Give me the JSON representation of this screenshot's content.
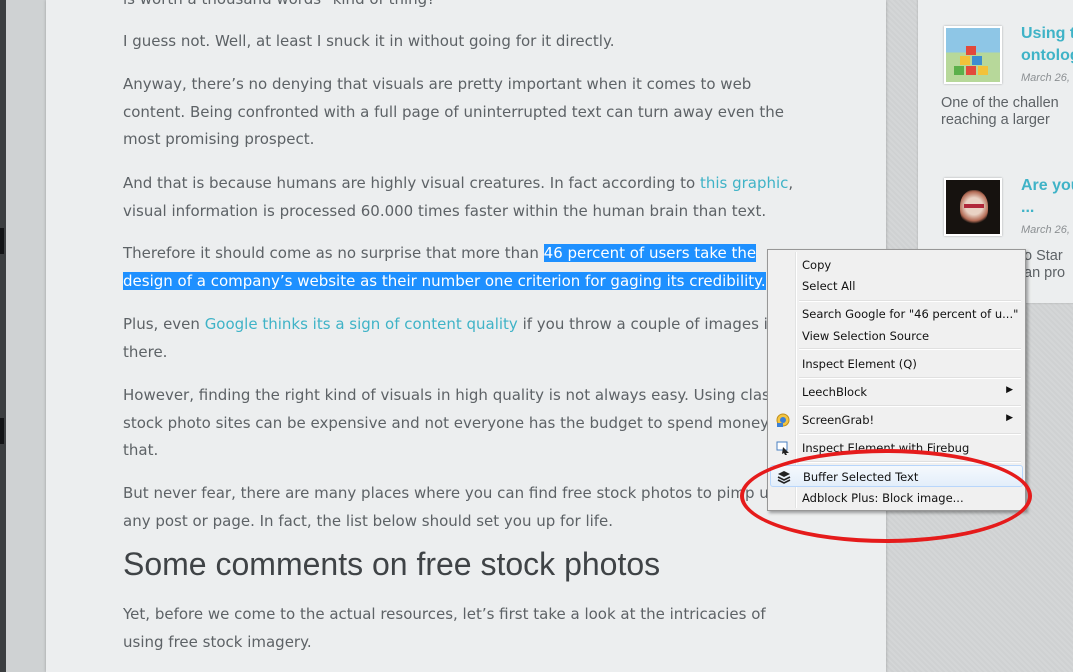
{
  "article": {
    "p0_fragment": "is worth a thousand words\" kind of thing?",
    "p1": "I guess not. Well, at least I snuck it in without going for it directly.",
    "p2_line1": "Anyway, there’s no denying that visuals are pretty important when it comes to web",
    "p2_line2": "content. Being confronted with a full page of uninterrupted text can turn away even the",
    "p2_line3": "most promising prospect.",
    "p3_line1_a": "And that is because humans are highly visual creatures. In fact according to ",
    "p3_link": "this graphic",
    "p3_line1_b": ",",
    "p3_line2": "visual information is processed 60.000 times faster within the human brain than text.",
    "p4_line1_a": "Therefore it should come as no surprise that more than ",
    "p4_selected_1": "46 percent of users take the",
    "p4_selected_2": "design of a company’s website as their number one criterion for gaging its credibility.",
    "p5_line1_a": "Plus, even ",
    "p5_link": "Google thinks its a sign of content quality",
    "p5_line1_b": " if you throw a couple of images in",
    "p5_line2": "there.",
    "p6_line1": "However, finding the right kind of visuals in high quality is not always easy. Using classic",
    "p6_line2": "stock photo sites can be expensive and not everyone has the budget to spend money on",
    "p6_line3": "that.",
    "p7_line1": "But never fear, there are many places where you can find free stock photos to pimp up",
    "p7_line2": "any post or page. In fact, the list below should set you up for life.",
    "heading": "Some comments on free stock photos",
    "p8_line1": "Yet, before we come to the actual resources, let’s first take a look at the intricacies of",
    "p8_line2": "using free stock imagery."
  },
  "sidebar": {
    "post1_title_l1": "Using t",
    "post1_title_l2": "ontolog",
    "post1_date": "March 26,",
    "post1_excerpt_l1": "One of the challen",
    "post1_excerpt_l2": "reaching a larger",
    "post2_title_l1": "Are you",
    "post2_title_l2": "...",
    "post2_date": "March 26,",
    "post2_excerpt_l1": "o Star",
    "post2_excerpt_l2": "an pro"
  },
  "context_menu": {
    "copy": "Copy",
    "select_all": "Select All",
    "search_google": "Search Google for \"46 percent of u...\"",
    "view_selection_source": "View Selection Source",
    "inspect_element": "Inspect Element (Q)",
    "leechblock": "LeechBlock",
    "screengrab": "ScreenGrab!",
    "inspect_firebug": "Inspect Element with Firebug",
    "buffer_selected_text": "Buffer Selected Text",
    "adblock_plus": "Adblock Plus: Block image...",
    "submenu_arrow": "▶"
  },
  "colors": {
    "link": "#3fb3c7",
    "selection": "#1e90ff",
    "annotation_circle": "#e51b1b"
  },
  "icons": {
    "screengrab": "screengrab-icon",
    "firebug": "firebug-icon",
    "buffer": "buffer-icon"
  }
}
